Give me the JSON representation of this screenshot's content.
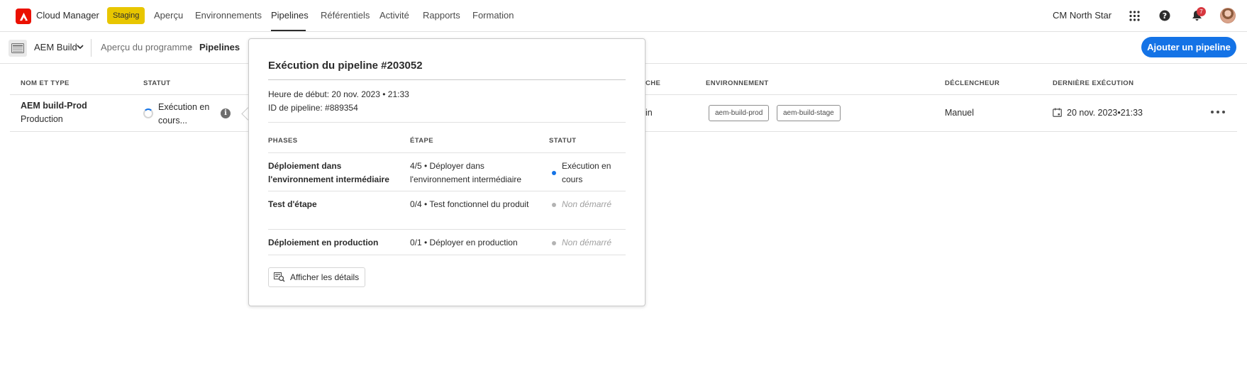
{
  "header": {
    "app_title": "Cloud Manager",
    "env_badge": "Staging",
    "tabs": [
      {
        "label": "Aperçu"
      },
      {
        "label": "Environnements"
      },
      {
        "label": "Pipelines",
        "active": true
      },
      {
        "label": "Référentiels"
      },
      {
        "label": "Activité"
      },
      {
        "label": "Rapports"
      },
      {
        "label": "Formation"
      }
    ],
    "org_name": "CM North Star",
    "notification_count": "7",
    "icons": [
      "apps-grid-icon",
      "help-icon",
      "bell-icon",
      "avatar"
    ]
  },
  "subheader": {
    "program_name": "AEM Build",
    "breadcrumb": [
      "Aperçu du programme",
      "Pipelines"
    ],
    "breadcrumb_separator": "›",
    "add_pipeline_label": "Ajouter un pipeline"
  },
  "table": {
    "columns": {
      "name_type": "Nom et type",
      "status": "Statut",
      "branch": "che",
      "environment": "Environnement",
      "trigger": "Déclencheur",
      "last_execution": "Dernière exécution"
    },
    "rows": [
      {
        "name": "AEM build-Prod",
        "type": "Production",
        "status": "Exécution en cours...",
        "info": "i",
        "branch": "ain",
        "environments": [
          "aem-build-prod",
          "aem-build-stage"
        ],
        "trigger": "Manuel",
        "last_execution": "20 nov. 2023•21:33"
      }
    ]
  },
  "popover": {
    "title": "Exécution du pipeline #203052",
    "start_time": "Heure de début: 20 nov. 2023 • 21:33",
    "pipeline_id": "ID de pipeline: #889354",
    "columns": {
      "phases": "Phases",
      "step": "Étape",
      "status": "Statut"
    },
    "phases": [
      {
        "name": "Déploiement dans l'environnement intermédiaire",
        "step": "4/5 • Déployer dans l'environnement intermédiaire",
        "status": "Exécution en cours",
        "state": "running"
      },
      {
        "name": "Test d'étape",
        "step": "0/4 • Test fonctionnel du produit",
        "status": "Non démarré",
        "state": "pending"
      },
      {
        "name": "Déploiement en production",
        "step": "0/1 • Déployer en production",
        "status": "Non démarré",
        "state": "pending"
      }
    ],
    "details_button": "Afficher les détails"
  },
  "colors": {
    "brand_red": "#eb1000",
    "accent_blue": "#1473e6",
    "staging_yellow": "#e8c600",
    "running_dot": "#1473e6",
    "pending_dot": "#b3b3b3",
    "notification_red": "#d7373f"
  }
}
